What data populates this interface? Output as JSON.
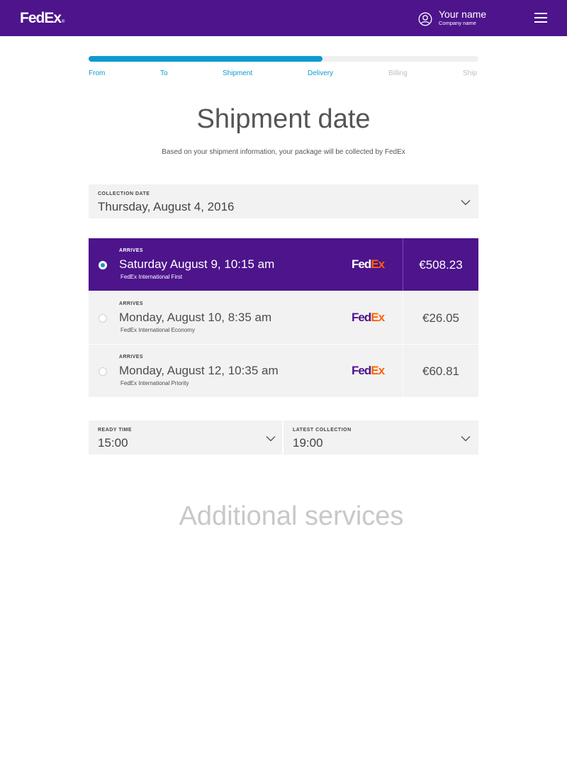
{
  "header": {
    "logo_fed": "Fed",
    "logo_ex": "Ex",
    "logo_reg": "®",
    "user_name": "Your name",
    "company_name": "Company name",
    "user_icon": "user-circle-icon",
    "menu_icon": "hamburger-menu-icon",
    "brand_color": "#4d148c"
  },
  "progress": {
    "value": 0.6,
    "color": "#0c9bcf",
    "steps": [
      {
        "label": "From",
        "active": true
      },
      {
        "label": "To",
        "active": true
      },
      {
        "label": "Shipment",
        "active": true
      },
      {
        "label": "Delivery",
        "active": true
      },
      {
        "label": "Billing",
        "active": false
      },
      {
        "label": "Ship",
        "active": false
      }
    ]
  },
  "main": {
    "title": "Shipment date",
    "subtitle": "Based on your shipment information, your package will be collected by FedEx"
  },
  "collection_date": {
    "label": "COLLECTION DATE",
    "value": "Thursday, August 4, 2016",
    "icon": "chevron-down-icon"
  },
  "options": [
    {
      "label": "ARRIVES",
      "date": "Saturday August 9, 10:15 am",
      "service": "FedEx International First",
      "price": "€508.23",
      "logo_fed": "Fed",
      "logo_ex": "Ex",
      "logo_dot": ".",
      "selected": true
    },
    {
      "label": "ARRIVES",
      "date": "Monday, August 10, 8:35 am",
      "service": "FedEx International Economy",
      "price": "€26.05",
      "logo_fed": "Fed",
      "logo_ex": "Ex",
      "logo_dot": ".",
      "selected": false
    },
    {
      "label": "ARRIVES",
      "date": "Monday, August 12, 10:35 am",
      "service": "FedEx International Priority",
      "price": "€60.81",
      "logo_fed": "Fed",
      "logo_ex": "Ex",
      "logo_dot": ".",
      "selected": false
    }
  ],
  "ready_time": {
    "label": "READY TIME",
    "value": "15:00"
  },
  "latest_collection": {
    "label": "LATEST COLLECTION",
    "value": "19:00"
  },
  "additional": {
    "title": "Additional services"
  }
}
